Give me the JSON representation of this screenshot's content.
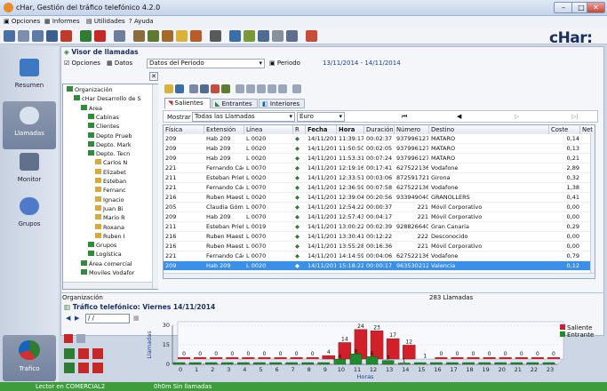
{
  "window": {
    "title": "cHar, Gestión del tráfico telefónico 4.2.0",
    "minimize": "–",
    "maximize": "□",
    "close": "✕"
  },
  "menu": [
    "Opciones",
    "Informes",
    "Utilidades",
    "Ayuda"
  ],
  "logo": "cHar:",
  "nav": {
    "resumen": "Resumen",
    "llamadas": "Llamadas",
    "monitor": "Monitor",
    "grupos": "Grupos",
    "trafico": "Trafico"
  },
  "visor": {
    "title": "Visor de llamadas",
    "opciones": "Opciones",
    "datos": "Datos",
    "period_select": "Datos del Periodo",
    "periodo_label": "Periodo",
    "periodo_value": "13/11/2014 - 14/11/2014"
  },
  "tree": {
    "items": [
      {
        "label": "Organización",
        "level": 0
      },
      {
        "label": "cHar Desarrollo de S",
        "level": 1
      },
      {
        "label": "Area",
        "level": 2
      },
      {
        "label": "Cabinas",
        "level": 3
      },
      {
        "label": "Clientes",
        "level": 3
      },
      {
        "label": "Depto Prueb",
        "level": 3
      },
      {
        "label": "Depto. Mark",
        "level": 3
      },
      {
        "label": "Depto. Tecn",
        "level": 3
      },
      {
        "label": "Carlos N",
        "level": 4
      },
      {
        "label": "Elizabet",
        "level": 4
      },
      {
        "label": "Esteban",
        "level": 4
      },
      {
        "label": "Fernanc",
        "level": 4
      },
      {
        "label": "Ignacio",
        "level": 4
      },
      {
        "label": "Juan Bi",
        "level": 4
      },
      {
        "label": "Mario R",
        "level": 4
      },
      {
        "label": "Roxana",
        "level": 4
      },
      {
        "label": "Ruben I",
        "level": 4
      },
      {
        "label": "Grupos",
        "level": 3
      },
      {
        "label": "Logística",
        "level": 3
      },
      {
        "label": "Área comercial",
        "level": 2
      },
      {
        "label": "Moviles Vodafor",
        "level": 2
      }
    ]
  },
  "tabs": {
    "salientes": "Salientes",
    "entrantes": "Entrantes",
    "interiores": "Interiores"
  },
  "filter": {
    "mostrar": "Mostrar",
    "tipo": "Todas las Llamadas",
    "moneda": "Euro"
  },
  "table": {
    "headers": [
      "Física",
      "Extensión",
      "Línea",
      "R",
      "Fecha",
      "Hora",
      "Duración",
      "Número",
      "Destino",
      "Coste",
      "Net"
    ],
    "rows": [
      [
        "209",
        "Hab 209",
        "L 0020",
        "14/11/2014",
        "11:39:17",
        "00:02:37",
        "937996127",
        "MATARO",
        "0,14"
      ],
      [
        "209",
        "Hab 209",
        "L 0020",
        "14/11/2014",
        "11:50:50",
        "00:02:05",
        "937996127",
        "MATARO",
        "0,13"
      ],
      [
        "209",
        "Hab 209",
        "L 0020",
        "14/11/2014",
        "11:53:31",
        "00:07:24",
        "937996127",
        "MATARO",
        "0,21"
      ],
      [
        "221",
        "Fernando Cáceres",
        "L 0070",
        "14/11/2014",
        "12:19:16",
        "00:17:41",
        "627522136",
        "Vodafone",
        "2,89"
      ],
      [
        "211",
        "Esteban Prieto",
        "L 0020",
        "14/11/2014",
        "12:33:51",
        "00:03:06",
        "872591721",
        "Girona",
        "0,32"
      ],
      [
        "221",
        "Fernando Cáceres",
        "L 0070",
        "14/11/2014",
        "12:36:59",
        "00:07:58",
        "627522136",
        "Vodafone",
        "1,38"
      ],
      [
        "216",
        "Ruben Maestre",
        "L 0020",
        "14/11/2014",
        "12:39:04",
        "00:20:56",
        "933949040",
        "GRANOLLERS",
        "0,41"
      ],
      [
        "205",
        "Claudia Gómez",
        "L 0070",
        "14/11/2014",
        "12:54:22",
        "00:00:37",
        "221",
        "Móvil Corporativo",
        "0,00"
      ],
      [
        "209",
        "Hab 209",
        "L 0070",
        "14/11/2014",
        "12:57:43",
        "00:04:17",
        "221",
        "Móvil Corporativo",
        "0,00"
      ],
      [
        "211",
        "Esteban Prieto",
        "L 0019",
        "14/11/2014",
        "13:00:22",
        "00:02:39",
        "928826640",
        "Gran Canaria",
        "0,29"
      ],
      [
        "216",
        "Ruben Maestre",
        "L 0070",
        "14/11/2014",
        "13:30:41",
        "00:12:22",
        "222",
        "Desconocido",
        "0,00"
      ],
      [
        "216",
        "Ruben Maestre",
        "L 0070",
        "14/11/2014",
        "13:55:28",
        "00:16:36",
        "221",
        "Móvil Corporativo",
        "0,00"
      ],
      [
        "221",
        "Fernando Cáceres",
        "L 0070",
        "14/11/2014",
        "14:14:59",
        "00:04:06",
        "627522136",
        "Vodafone",
        "0,79"
      ],
      [
        "209",
        "Hab 209",
        "L 0020",
        "14/11/2014",
        "15:18:22",
        "00:00:17",
        "963530212",
        "Valencia",
        "0,12"
      ]
    ]
  },
  "org_label": "Organización",
  "count": "283 Llamadas",
  "traffic": {
    "title": "Tráfico telefónico: Viernes 14/11/2014",
    "date_input": "/ /",
    "legend": [
      "Saliente",
      "Entrante"
    ]
  },
  "chart_data": {
    "type": "bar",
    "title": "Tráfico telefónico: Viernes 14/11/2014",
    "xlabel": "Horas",
    "ylabel": "Llamadas",
    "ylim": [
      0,
      30
    ],
    "yticks": [
      "0",
      "15",
      "30"
    ],
    "categories": [
      "0",
      "1",
      "2",
      "3",
      "4",
      "5",
      "6",
      "7",
      "8",
      "9",
      "10",
      "11",
      "12",
      "13",
      "14",
      "15",
      "16",
      "17",
      "18",
      "19",
      "20",
      "21",
      "22",
      "23"
    ],
    "series": [
      {
        "name": "Saliente",
        "color": "#d2202a",
        "values": [
          0,
          0,
          0,
          0,
          0,
          0,
          0,
          0,
          0,
          4,
          14,
          24,
          23,
          17,
          12,
          1,
          0,
          0,
          0,
          0,
          0,
          0,
          0,
          0
        ]
      },
      {
        "name": "Entrante",
        "color": "#1f8a2e",
        "values": [
          0,
          0,
          0,
          0,
          0,
          0,
          0,
          0,
          0,
          0,
          4,
          8,
          6,
          3,
          1,
          0,
          0,
          0,
          0,
          0,
          0,
          0,
          0,
          0
        ]
      }
    ]
  },
  "status": {
    "left": "Lector en COMERCIAL2",
    "right": "0h0m Sin llamadas"
  },
  "colors": {
    "accent": "#3a8fe8",
    "status_green": "#3f9c3c",
    "dark_blue": "#1b2f63"
  }
}
